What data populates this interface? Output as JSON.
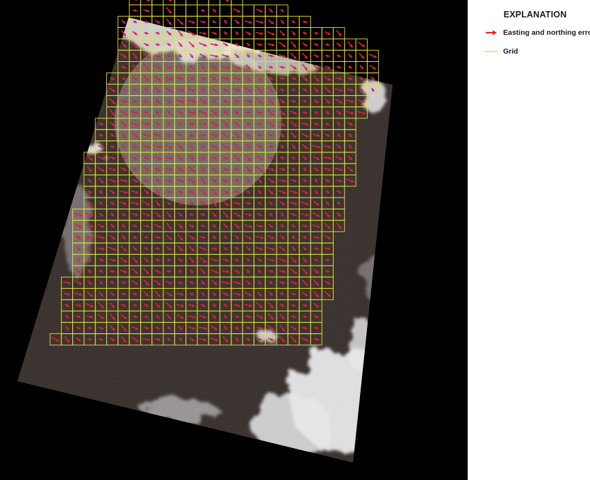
{
  "legend": {
    "title": "EXPLANATION",
    "items": [
      {
        "label": "Easting and northing error",
        "symbol": "red-arrow-icon",
        "color": "#e8202a"
      },
      {
        "label": "Grid",
        "symbol": "yellow-line-icon",
        "color": "#f2e234"
      }
    ]
  },
  "colors": {
    "background": "#000000",
    "grid": "#f2e234",
    "arrow": "#e8202a",
    "page": "#ffffff"
  }
}
